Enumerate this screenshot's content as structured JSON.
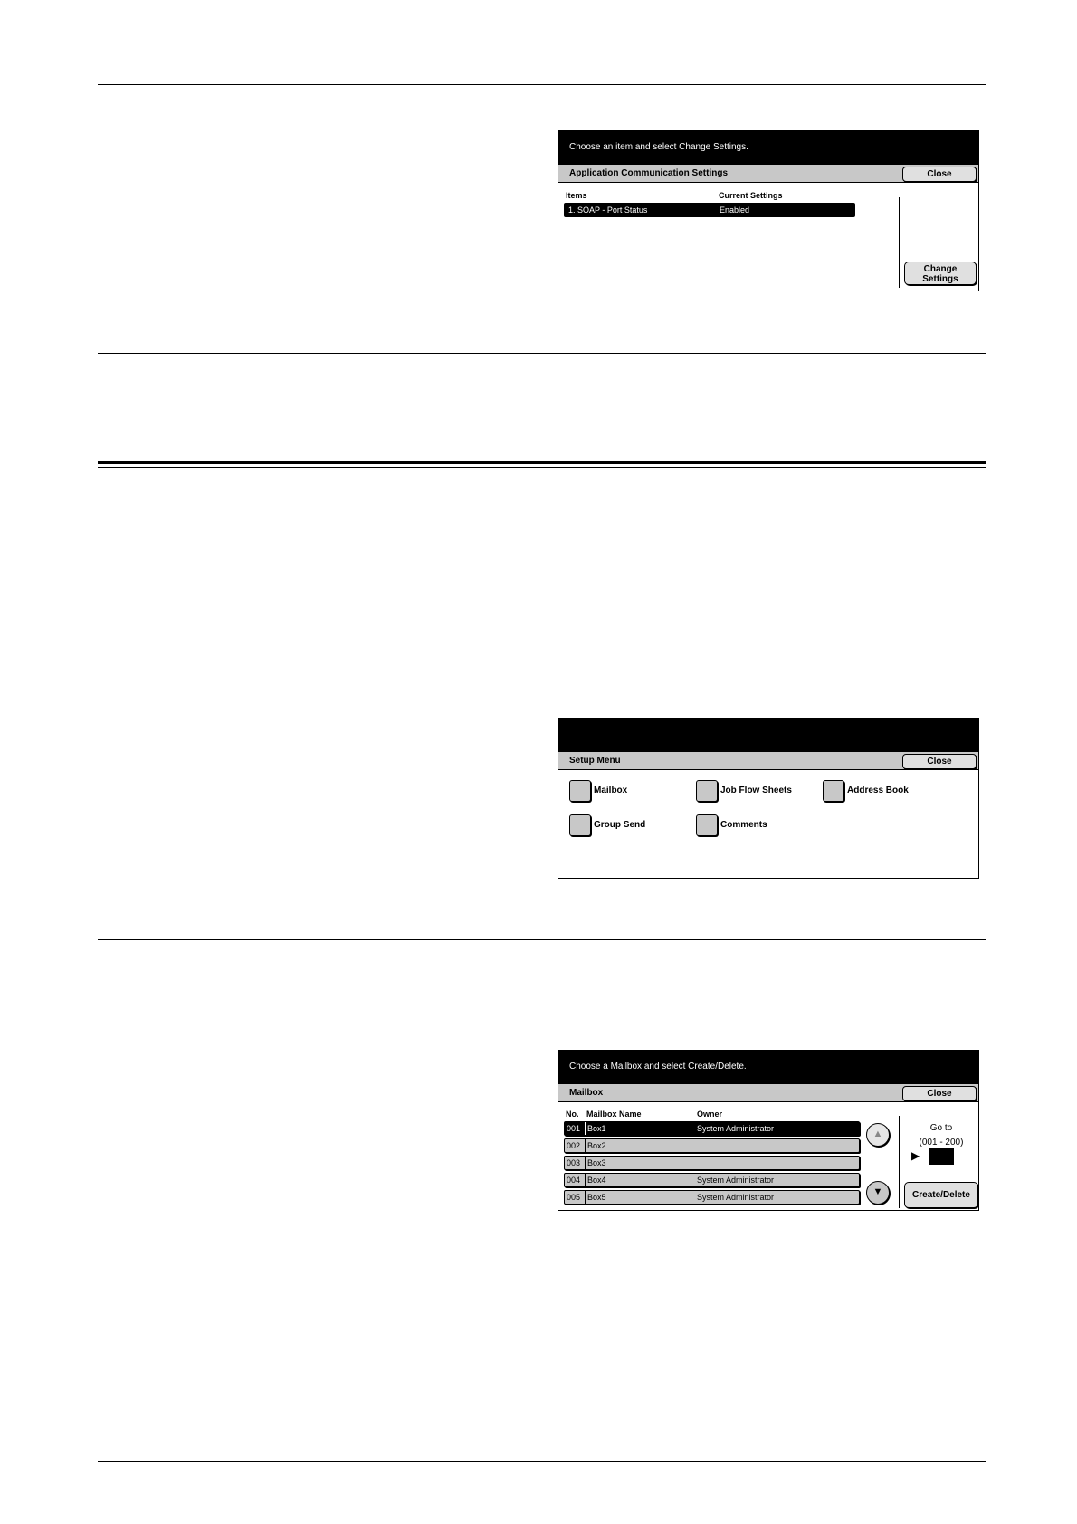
{
  "panel1": {
    "message": "Choose an item and select Change Settings.",
    "title": "Application Communication Settings",
    "close_label": "Close",
    "col_items": "Items",
    "col_current": "Current Settings",
    "row_item": "1. SOAP - Port Status",
    "row_value": "Enabled",
    "change_line1": "Change",
    "change_line2": "Settings"
  },
  "panel2": {
    "title": "Setup Menu",
    "close_label": "Close",
    "buttons": [
      "Mailbox",
      "Job Flow Sheets",
      "Address Book",
      "Group Send",
      "Comments"
    ]
  },
  "panel3": {
    "message": "Choose a Mailbox and select Create/Delete.",
    "title": "Mailbox",
    "close_label": "Close",
    "col_no": "No.",
    "col_name": "Mailbox Name",
    "col_owner": "Owner",
    "rows": [
      {
        "no": "001",
        "name": "Box1",
        "owner": "System Administrator"
      },
      {
        "no": "002",
        "name": "Box2",
        "owner": ""
      },
      {
        "no": "003",
        "name": "Box3",
        "owner": ""
      },
      {
        "no": "004",
        "name": "Box4",
        "owner": "System Administrator"
      },
      {
        "no": "005",
        "name": "Box5",
        "owner": "System Administrator"
      }
    ],
    "goto_label": "Go to",
    "goto_range": "(001 - 200)",
    "goto_arrow": "▶",
    "create_delete_label": "Create/Delete"
  },
  "colors": {
    "bar": "#000000",
    "title": "#c8c8c8",
    "button": "#e0e0e0"
  },
  "icons": {
    "up": "scroll-up-icon",
    "down": "scroll-down-icon"
  }
}
